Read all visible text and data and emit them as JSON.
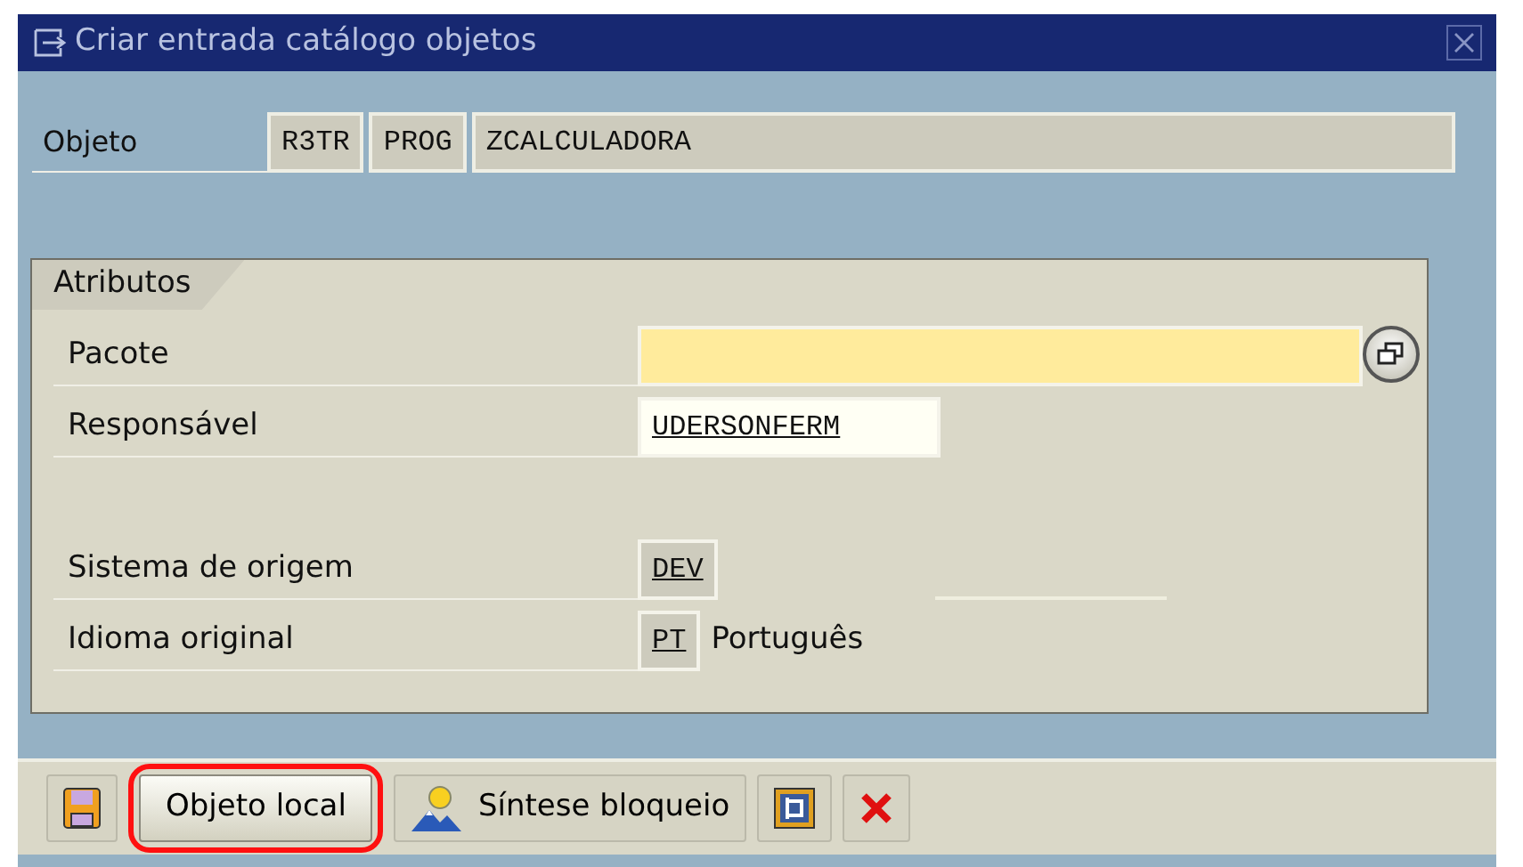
{
  "window": {
    "title": "Criar entrada catálogo objetos"
  },
  "object": {
    "label": "Objeto",
    "parts": [
      "R3TR",
      "PROG",
      "ZCALCULADORA"
    ]
  },
  "group": {
    "title": "Atributos",
    "rows": [
      {
        "kind": "input",
        "label": "Pacote",
        "required": true,
        "value_help": true
      },
      {
        "kind": "input",
        "label": "Responsável",
        "value": "UDERSONFERM",
        "required": false
      },
      {
        "kind": "spacer"
      },
      {
        "kind": "display",
        "label": "Sistema de origem",
        "value": "DEV",
        "extra_field": true
      },
      {
        "kind": "display",
        "label": "Idioma original",
        "value": "PT",
        "description": "Português"
      }
    ]
  },
  "toolbar": [
    {
      "kind": "save-icon"
    },
    {
      "kind": "text",
      "label": "Objeto local",
      "highlighted": true
    },
    {
      "kind": "icon-text",
      "label": "Síntese bloqueio"
    },
    {
      "kind": "frame-icon"
    },
    {
      "kind": "cancel-icon"
    }
  ]
}
